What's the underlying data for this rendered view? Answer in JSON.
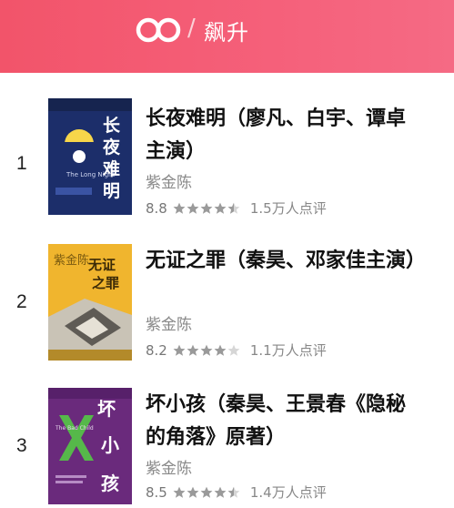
{
  "header": {
    "title": "飙升",
    "separator": "/"
  },
  "books": [
    {
      "rank": "1",
      "title": "长夜难明（廖凡、白宇、谭卓主演）",
      "author": "紫金陈",
      "score": "8.8",
      "stars": 4.5,
      "reviews": "1.5万人点评",
      "cover_text": "长夜难明",
      "cover_sub": "The Long Night"
    },
    {
      "rank": "2",
      "title": "无证之罪（秦昊、邓家佳主演）",
      "author": "紫金陈",
      "score": "8.2",
      "stars": 4.0,
      "reviews": "1.1万人点评",
      "cover_text": "无证之罪",
      "cover_author": "紫金陈"
    },
    {
      "rank": "3",
      "title": "坏小孩（秦昊、王景春《隐秘的角落》原著）",
      "author": "紫金陈",
      "score": "8.5",
      "stars": 4.5,
      "reviews": "1.4万人点评",
      "cover_text": "坏小孩",
      "cover_sub": "The Bad Child"
    }
  ],
  "colors": {
    "header": "#f2546a",
    "star_filled": "#9a9a9a",
    "star_empty": "#d6d6d6"
  }
}
